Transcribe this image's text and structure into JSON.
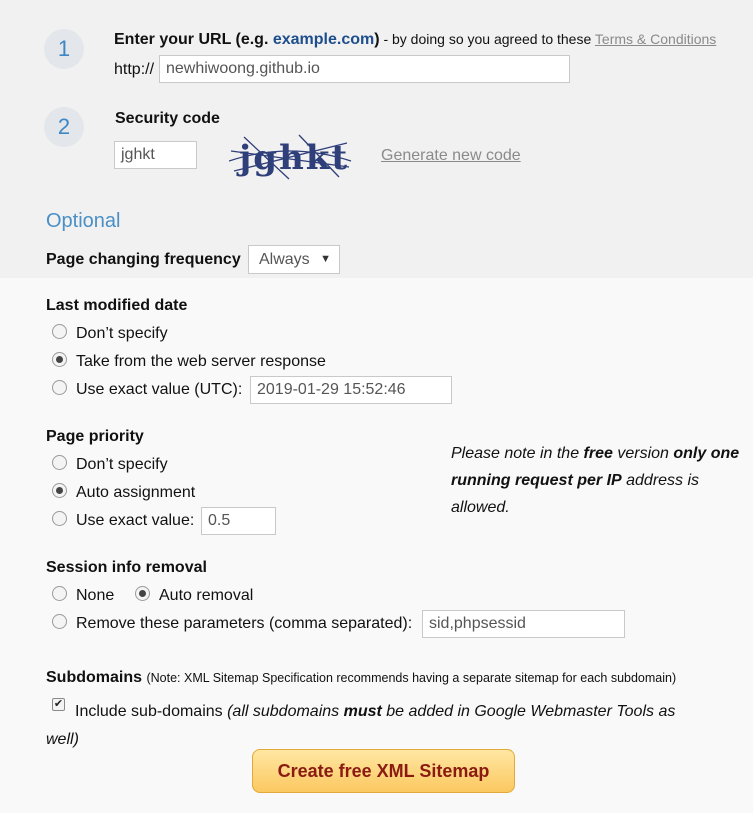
{
  "step1": {
    "number": "1",
    "title_prefix": "Enter your URL (e.g. ",
    "title_example": "example.com",
    "title_suffix": ")",
    "agreement": " - by doing so you agreed to these ",
    "terms_link": "Terms & Conditions",
    "protocol": "http://",
    "url_value": "newhiwoong.github.io"
  },
  "step2": {
    "number": "2",
    "title": "Security code",
    "code_value": "jghkt",
    "captcha_text": "jghkt",
    "generate_link": "Generate new code"
  },
  "optional_heading": "Optional",
  "frequency": {
    "label": "Page changing frequency",
    "selected": "Always"
  },
  "last_modified": {
    "title": "Last modified date",
    "options": [
      "Don’t specify",
      "Take from the web server response",
      "Use exact value (UTC):"
    ],
    "selected_index": 1,
    "exact_value": "2019-01-29 15:52:46"
  },
  "priority": {
    "title": "Page priority",
    "options": [
      "Don’t specify",
      "Auto assignment",
      "Use exact value:"
    ],
    "selected_index": 1,
    "exact_value": "0.5"
  },
  "note": {
    "part1": "Please note in the ",
    "free": "free",
    "part2": " version ",
    "only": "only one running request per IP",
    "part3": " address is allowed."
  },
  "session": {
    "title": "Session info removal",
    "option_none": "None",
    "option_auto": "Auto removal",
    "option_remove": "Remove these parameters (comma separated):",
    "params_value": "sid,phpsessid",
    "selected": "auto"
  },
  "subdomains": {
    "title": "Subdomains",
    "note": "(Note: XML Sitemap Specification recommends having a separate sitemap for each subdomain)",
    "checkbox_label": "Include sub-domains",
    "hint_part1": "(all subdomains ",
    "hint_must": "must",
    "hint_part2": " be added in Google Webmaster Tools as",
    "hint_part3": "well)",
    "checked": true
  },
  "submit_label": "Create free XML Sitemap",
  "colors": {
    "accent": "#4a8fc5",
    "button_text": "#8b1a12",
    "button_bg": "#fbc860"
  }
}
